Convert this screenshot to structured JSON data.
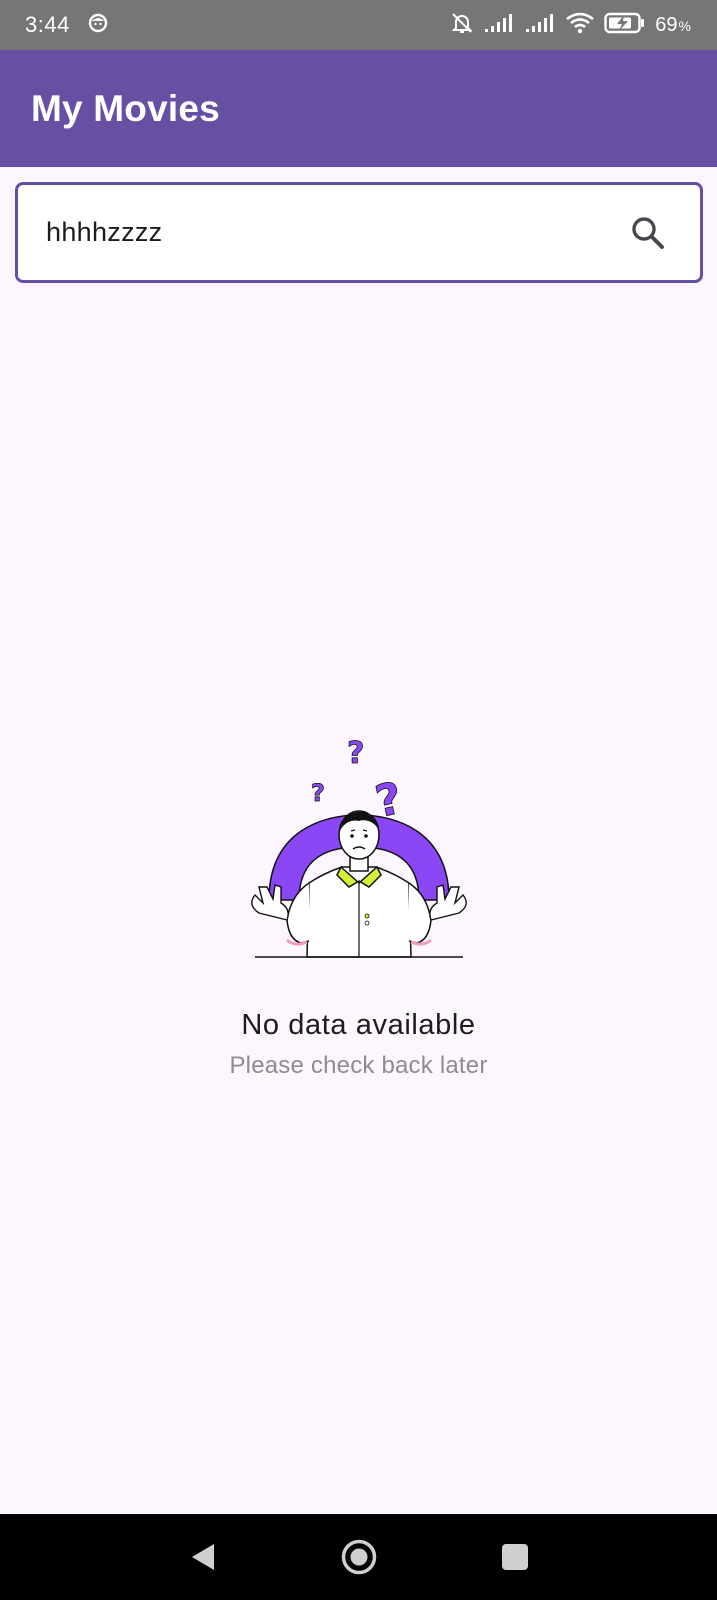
{
  "status_bar": {
    "time": "3:44",
    "battery_level": "69",
    "battery_unit": "%",
    "icons": [
      "face-icon",
      "bell-off-icon",
      "signal-icon",
      "signal-icon",
      "wifi-icon",
      "battery-charging-icon"
    ]
  },
  "app_bar": {
    "title": "My Movies",
    "color": "#6750A4"
  },
  "search": {
    "value": "hhhhzzzz",
    "icon": "search-icon"
  },
  "empty_state": {
    "title": "No data available",
    "subtitle": "Please check back later",
    "illustration": "confused-person-illustration",
    "accent_color": "#8B47F5"
  },
  "nav_bar": {
    "buttons": [
      "back-icon",
      "home-icon",
      "recents-icon"
    ]
  }
}
